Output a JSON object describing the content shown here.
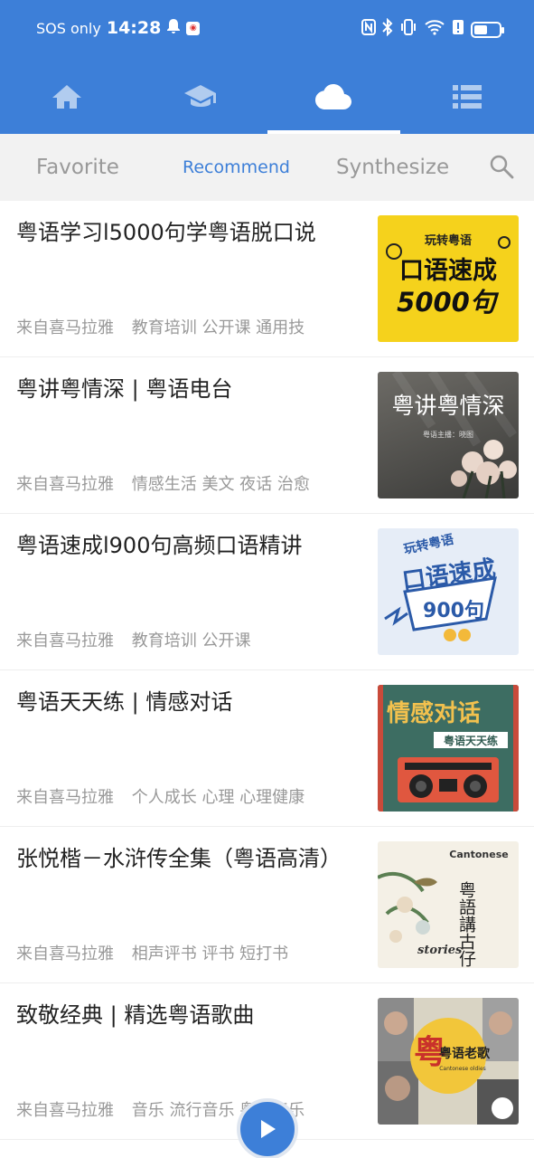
{
  "status_bar": {
    "carrier": "SOS only",
    "time": "14:28",
    "battery_level": 0.55
  },
  "nav_tabs": [
    {
      "icon": "home-icon",
      "active": false
    },
    {
      "icon": "graduation-cap-icon",
      "active": false
    },
    {
      "icon": "cloud-icon",
      "active": true
    },
    {
      "icon": "list-icon",
      "active": false
    }
  ],
  "sub_tabs": [
    {
      "label": "Favorite",
      "active": false
    },
    {
      "label": "Recommend",
      "active": true
    },
    {
      "label": "Synthesize",
      "active": false
    }
  ],
  "items": [
    {
      "title": "粤语学习l5000句学粤语脱口说",
      "source": "来自喜马拉雅",
      "tags": "教育培训 公开课 通用技",
      "thumb": {
        "bg": "#f5d21c",
        "top": "玩转粤语",
        "main": "口语速成",
        "sub": "5000句"
      }
    },
    {
      "title": "粤讲粤情深 | 粤语电台",
      "source": "来自喜马拉雅",
      "tags": "情感生活 美文 夜话 治愈",
      "thumb": {
        "bg": "#4a4a48",
        "main": "粤讲粤情深",
        "sub": "粤语主播：晓图"
      }
    },
    {
      "title": "粤语速成l900句高频口语精讲",
      "source": "来自喜马拉雅",
      "tags": "教育培训 公开课",
      "thumb": {
        "bg": "#e6edf7",
        "top": "玩转粤语",
        "main": "口语速成",
        "sub": "900句"
      }
    },
    {
      "title": "粤语天天练 | 情感对话",
      "source": "来自喜马拉雅",
      "tags": "个人成长 心理 心理健康",
      "thumb": {
        "bg": "#3d6d62",
        "main": "情感对话",
        "sub": "粤语天天练"
      }
    },
    {
      "title": "张悦楷－水浒传全集（粤语高清）",
      "source": "来自喜马拉雅",
      "tags": "相声评书 评书 短打书",
      "thumb": {
        "bg": "#f4f0e6",
        "top": "Cantonese",
        "main": "粤語講古仔",
        "sub": "stories"
      }
    },
    {
      "title": "致敬经典 | 精选粤语歌曲",
      "source": "来自喜马拉雅",
      "tags": "音乐 流行音乐 粤语音乐",
      "thumb": {
        "bg": "#d9d4c4",
        "main": "粤语老歌",
        "sub": "Cantonese oldies"
      }
    }
  ]
}
